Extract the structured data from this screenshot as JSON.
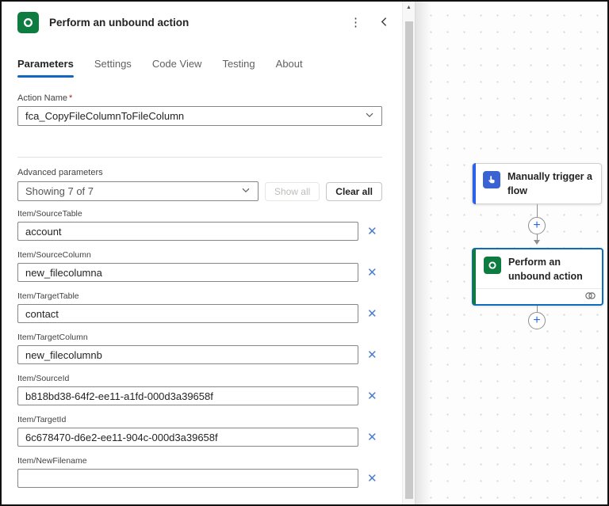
{
  "panel": {
    "title": "Perform an unbound action",
    "tabs": [
      "Parameters",
      "Settings",
      "Code View",
      "Testing",
      "About"
    ],
    "action_name": {
      "label": "Action Name",
      "required_marker": "*",
      "value": "fca_CopyFileColumnToFileColumn"
    },
    "advanced": {
      "label": "Advanced parameters",
      "selected": "Showing 7 of 7",
      "show_all_label": "Show all",
      "clear_all_label": "Clear all"
    },
    "fields": [
      {
        "label": "Item/SourceTable",
        "value": "account"
      },
      {
        "label": "Item/SourceColumn",
        "value": "new_filecolumna"
      },
      {
        "label": "Item/TargetTable",
        "value": "contact"
      },
      {
        "label": "Item/TargetColumn",
        "value": "new_filecolumnb"
      },
      {
        "label": "Item/SourceId",
        "value": "b818bd38-64f2-ee11-a1fd-000d3a39658f"
      },
      {
        "label": "Item/TargetId",
        "value": "6c678470-d6e2-ee11-904c-000d3a39658f"
      },
      {
        "label": "Item/NewFilename",
        "value": ""
      }
    ]
  },
  "canvas": {
    "trigger_card": {
      "title": "Manually trigger a flow"
    },
    "action_card": {
      "title": "Perform an unbound action"
    }
  },
  "icons": {
    "kebab": "⋮",
    "scroll_up": "▲",
    "plus": "+",
    "dismiss": "✕"
  },
  "colors": {
    "selected_border_blue": "#0f6cbd",
    "tab_underline_blue": "#1267c1",
    "dataverse_green": "#0e7b41",
    "trigger_icon_blue": "#3a62d3",
    "trigger_accent_blue": "#2b62e8",
    "dismiss_blue": "#4a7bd0"
  }
}
